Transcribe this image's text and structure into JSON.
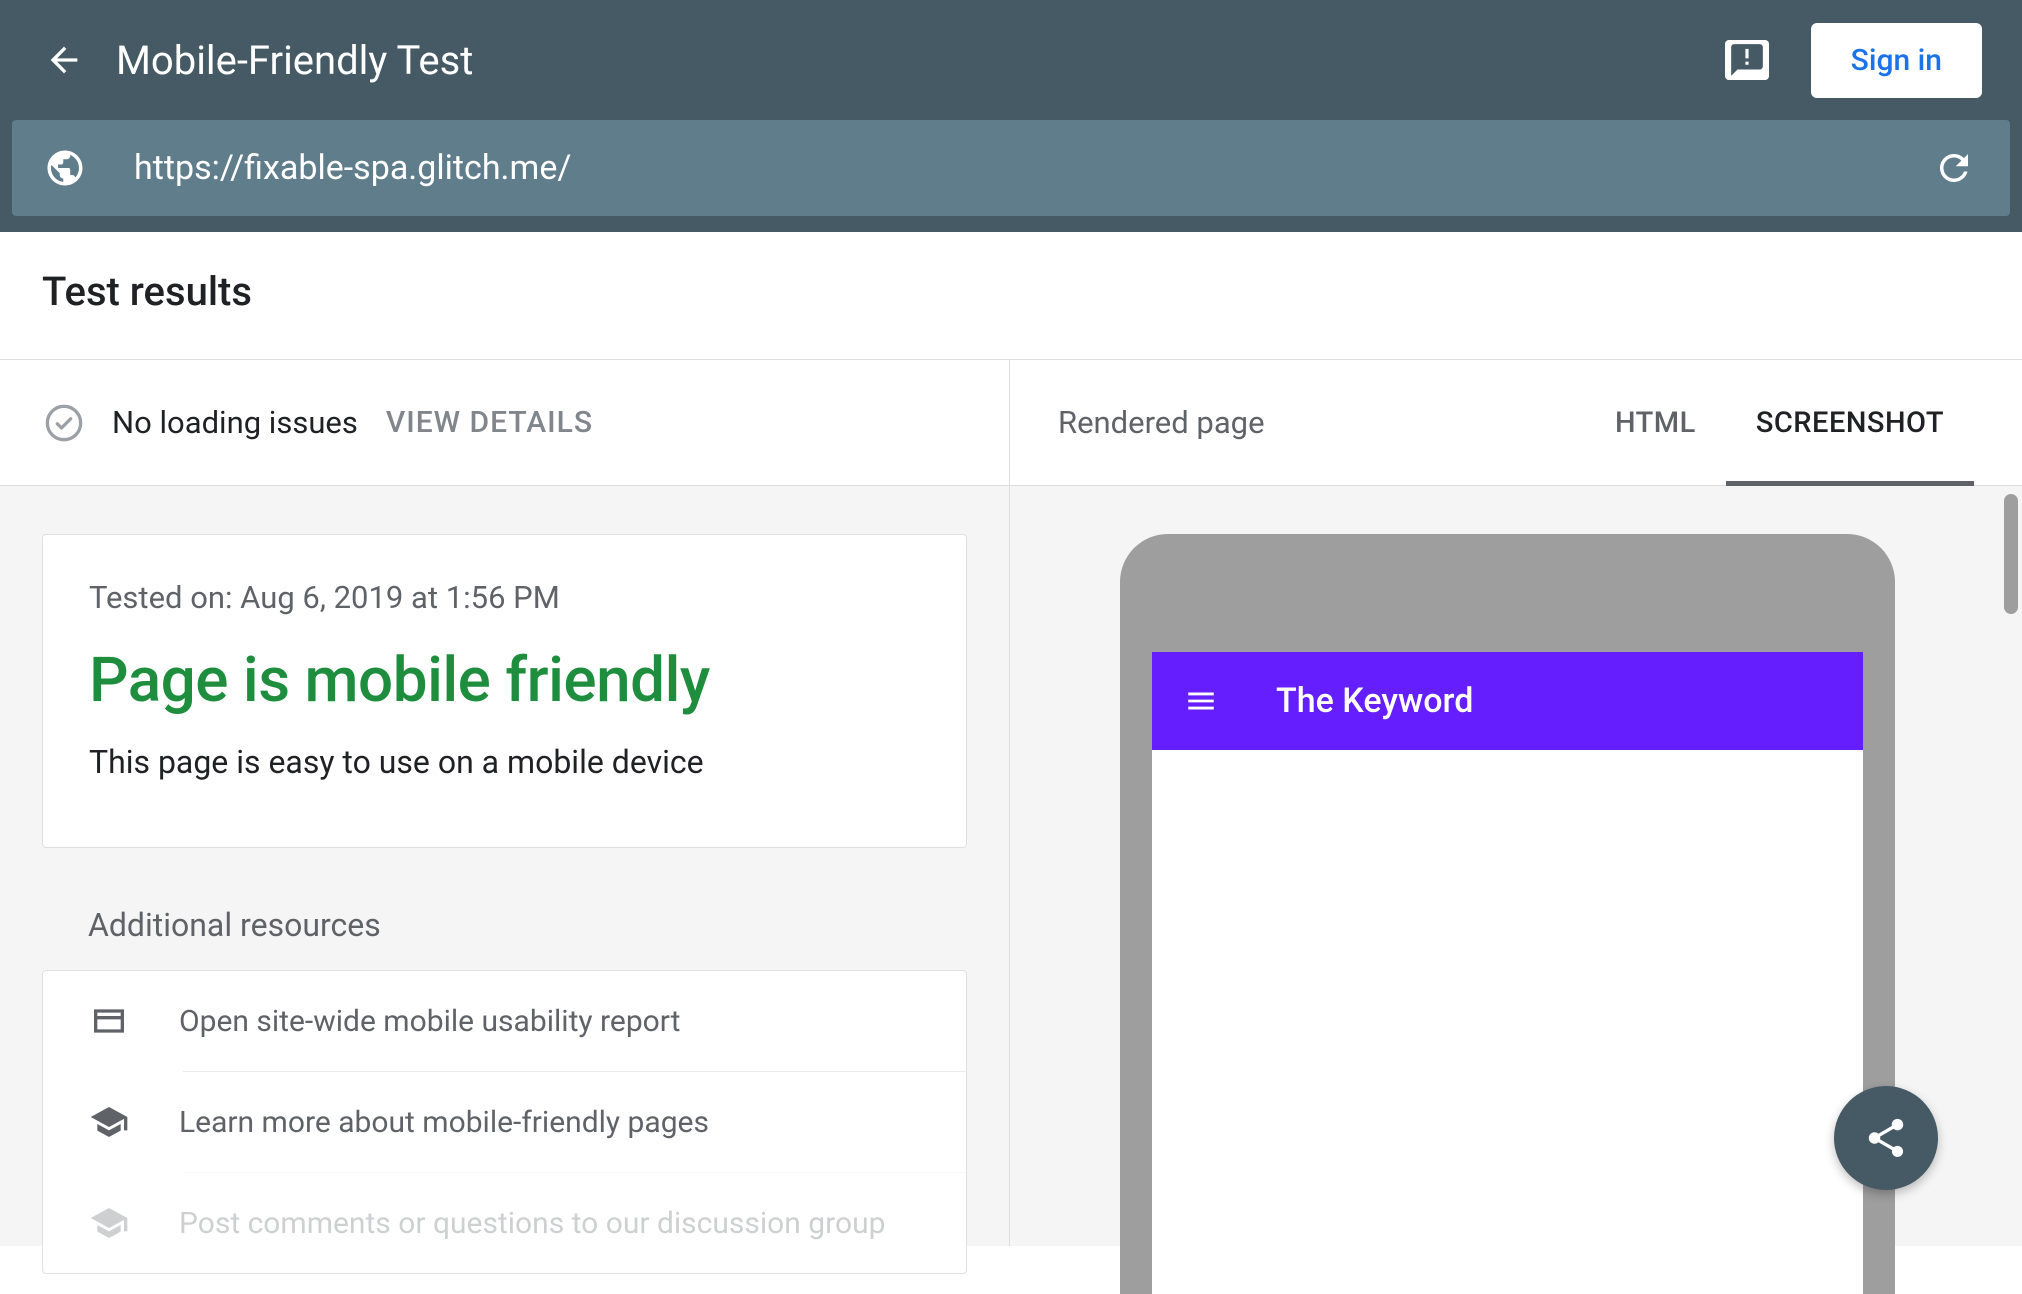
{
  "header": {
    "title": "Mobile-Friendly Test",
    "signin_label": "Sign in"
  },
  "url": "https://fixable-spa.glitch.me/",
  "results": {
    "heading": "Test results",
    "loading_status": "No loading issues",
    "view_details_label": "VIEW DETAILS",
    "tested_on": "Tested on: Aug 6, 2019 at 1:56 PM",
    "verdict": "Page is mobile friendly",
    "verdict_sub": "This page is easy to use on a mobile device"
  },
  "resources": {
    "heading": "Additional resources",
    "items": [
      {
        "label": "Open site-wide mobile usability report",
        "icon": "web-icon"
      },
      {
        "label": "Learn more about mobile-friendly pages",
        "icon": "school-icon"
      },
      {
        "label": "Post comments or questions to our discussion group",
        "icon": "school-icon"
      }
    ]
  },
  "right": {
    "rendered_label": "Rendered page",
    "tabs": {
      "html": "HTML",
      "screenshot": "SCREENSHOT"
    }
  },
  "phone": {
    "app_title": "The Keyword"
  }
}
